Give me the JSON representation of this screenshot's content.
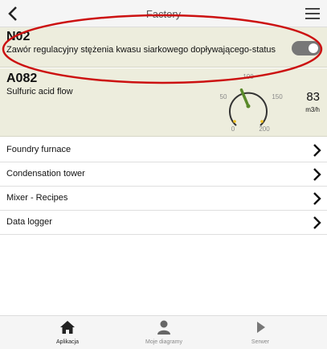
{
  "header": {
    "title": "Factory",
    "back_icon": "chevron-left-icon",
    "menu_icon": "hamburger-menu-icon"
  },
  "status_card": {
    "code": "N02",
    "description": "Zawór regulacyjny stężenia kwasu siarkowego dopływającego-status",
    "toggle_on": true,
    "highlight_color": "#cc1111"
  },
  "flow_card": {
    "code": "A082",
    "label": "Sulfuric acid flow",
    "value": "83",
    "unit": "m3/h",
    "gauge": {
      "min": 0,
      "max": 200,
      "ticks": [
        "0",
        "50",
        "100",
        "150",
        "200"
      ],
      "reading": 83,
      "needle_color": "#5a8a2a",
      "arc_color": "#333333"
    }
  },
  "nav_items": [
    {
      "label": "Foundry furnace"
    },
    {
      "label": "Condensation tower"
    },
    {
      "label": "Mixer - Recipes"
    },
    {
      "label": "Data logger"
    }
  ],
  "tabs": [
    {
      "label": "Aplikacja",
      "icon": "home-icon",
      "active": true
    },
    {
      "label": "Moje diagramy",
      "icon": "user-icon",
      "active": false
    },
    {
      "label": "Serwer",
      "icon": "play-icon",
      "active": false
    }
  ],
  "colors": {
    "card_bg": "#ededdd",
    "active_tab": "#222222",
    "inactive_tab": "#888888"
  }
}
